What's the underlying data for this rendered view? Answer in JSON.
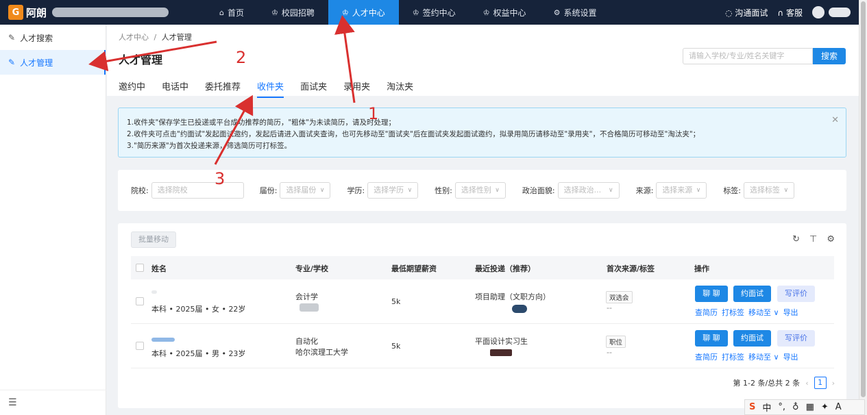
{
  "topbar": {
    "logo_text": "阿朗",
    "nav": [
      {
        "label": "首页",
        "icon": "home-icon"
      },
      {
        "label": "校园招聘",
        "icon": "crown-icon"
      },
      {
        "label": "人才中心",
        "icon": "crown-icon",
        "active": true
      },
      {
        "label": "签约中心",
        "icon": "crown-icon"
      },
      {
        "label": "权益中心",
        "icon": "crown-icon"
      },
      {
        "label": "系统设置",
        "icon": "gear-icon"
      }
    ],
    "interview_label": "沟通面试",
    "service_label": "客服"
  },
  "sidebar": {
    "items": [
      {
        "label": "人才搜索",
        "icon": "edit-icon"
      },
      {
        "label": "人才管理",
        "icon": "edit-icon",
        "active": true
      }
    ]
  },
  "breadcrumb": {
    "root": "人才中心",
    "sep": "/",
    "current": "人才管理"
  },
  "page": {
    "title": "人才管理",
    "search_placeholder": "请输入学校/专业/姓名关键字",
    "search_button": "搜索",
    "tabs": [
      "邀约中",
      "电话中",
      "委托推荐",
      "收件夹",
      "面试夹",
      "录用夹",
      "淘汰夹"
    ],
    "active_tab": "收件夹"
  },
  "info": {
    "lines": [
      "1.收件夹\"保存学生已投递或平台成功推荐的简历，\"粗体\"为未读简历，请及时处理；",
      "2.收件夹可点击\"约面试\"发起面试邀约，发起后请进入面试夹查询，也可先移动至\"面试夹\"后在面试夹发起面试邀约，拟录用简历请移动至\"录用夹\"，不合格简历可移动至\"淘汰夹\"；",
      "3.\"简历来源\"为首次投递来源，筛选简历可打标签。"
    ]
  },
  "filters": {
    "school": {
      "label": "院校:",
      "placeholder": "选择院校"
    },
    "grade": {
      "label": "届份:",
      "placeholder": "选择届份"
    },
    "education": {
      "label": "学历:",
      "placeholder": "选择学历"
    },
    "gender": {
      "label": "性别:",
      "placeholder": "选择性别"
    },
    "political": {
      "label": "政治面貌:",
      "placeholder": "选择政治..."
    },
    "source": {
      "label": "来源:",
      "placeholder": "选择来源"
    },
    "tag": {
      "label": "标签:",
      "placeholder": "选择标签"
    }
  },
  "table": {
    "batch_button": "批量移动",
    "columns": [
      "姓名",
      "专业/学校",
      "最低期望薪资",
      "最近投递（推荐）",
      "首次来源/标签",
      "操作"
    ],
    "rows": [
      {
        "meta": "本科 • 2025届 • 女 • 22岁",
        "major": "会计学",
        "school": "",
        "salary": "5k",
        "position": "项目助理（文职方向）",
        "source": "双选会",
        "tag": "--"
      },
      {
        "meta": "本科 • 2025届 • 男 • 23岁",
        "major": "自动化",
        "school": "哈尔滨理工大学",
        "salary": "5k",
        "position": "平面设计实习生",
        "source": "职位",
        "tag": "--"
      }
    ],
    "actions": {
      "chat": "聊 聊",
      "invite": "约面试",
      "review": "写评价",
      "view": "查简历",
      "tag": "打标签",
      "move": "移动至",
      "export": "导出"
    },
    "pager": {
      "summary": "第 1-2 条/总共 2 条",
      "page": "1"
    }
  },
  "annotations": [
    "1",
    "2",
    "3"
  ],
  "ime": {
    "lang": "中"
  }
}
